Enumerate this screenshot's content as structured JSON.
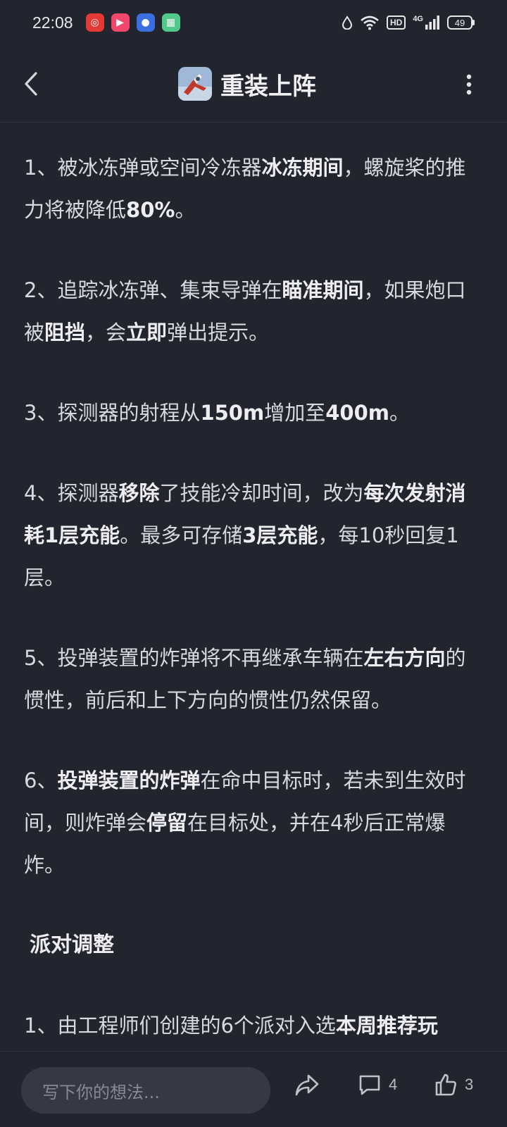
{
  "status_bar": {
    "time": "22:08",
    "network": "4G",
    "hd": "HD",
    "battery": "49"
  },
  "header": {
    "title": "重装上阵"
  },
  "content": {
    "p1": {
      "a": "1、被冰冻弹或空间冷冻器",
      "b": "冰冻期间",
      "c": "，螺旋桨的推力将被降低",
      "d": "80%",
      "e": "。"
    },
    "p2": {
      "a": "2、追踪冰冻弹、集束导弹在",
      "b": "瞄准期间",
      "c": "，如果炮口被",
      "d": "阻挡",
      "e": "，会",
      "f": "立即",
      "g": "弹出提示。"
    },
    "p3": {
      "a": "3、探测器的射程从",
      "b": "150m",
      "c": "增加至",
      "d": "400m",
      "e": "。"
    },
    "p4": {
      "a": "4、探测器",
      "b": "移除",
      "c": "了技能冷却时间，改为",
      "d": "每次发射消耗1层充能",
      "e": "。最多可存储",
      "f": "3层充能",
      "g": "，每10秒回复1层。"
    },
    "p5": {
      "a": "5、投弹装置的炸弹将不再继承车辆在",
      "b": "左右方向",
      "c": "的惯性，前后和上下方向的惯性仍然保留。"
    },
    "p6": {
      "a": "6、",
      "b": "投弹装置的炸弹",
      "c": "在命中目标时，若未到生效时间，则炸弹会",
      "d": "停留",
      "e": "在目标处，并在4秒后正常爆炸。"
    },
    "section_title": "派对调整",
    "p7": {
      "a": "1、由工程师们创建的6个派对入选",
      "b": "本周推荐玩"
    }
  },
  "bottom_bar": {
    "placeholder": "写下你的想法...",
    "comment_count": "4",
    "like_count": "3"
  },
  "icons": [
    "back-icon",
    "game-icon",
    "more-icon",
    "share-icon",
    "comment-icon",
    "like-icon"
  ]
}
